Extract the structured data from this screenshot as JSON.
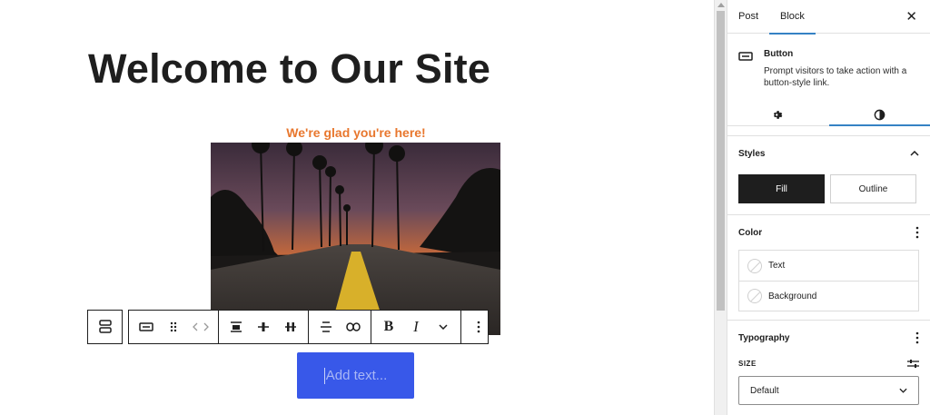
{
  "canvas": {
    "page_title": "Welcome to Our Site",
    "tagline": "We're glad you're here!",
    "button_placeholder": "Add text...",
    "toolbar": {
      "bold_label": "B",
      "italic_label": "I"
    }
  },
  "sidebar": {
    "tabs": [
      {
        "label": "Post"
      },
      {
        "label": "Block"
      }
    ],
    "close_icon": "✕",
    "block_card": {
      "title": "Button",
      "description": "Prompt visitors to take action with a button-style link."
    },
    "styles": {
      "heading": "Styles",
      "options": [
        {
          "label": "Fill"
        },
        {
          "label": "Outline"
        }
      ]
    },
    "color": {
      "heading": "Color",
      "items": [
        {
          "label": "Text"
        },
        {
          "label": "Background"
        }
      ]
    },
    "typography": {
      "heading": "Typography",
      "size_label": "SIZE",
      "size_value": "Default"
    }
  },
  "colors": {
    "accent": "#3858e9",
    "tagline": "#e8772e",
    "tab_indicator": "#3582c4",
    "text": "#1e1e1e"
  }
}
